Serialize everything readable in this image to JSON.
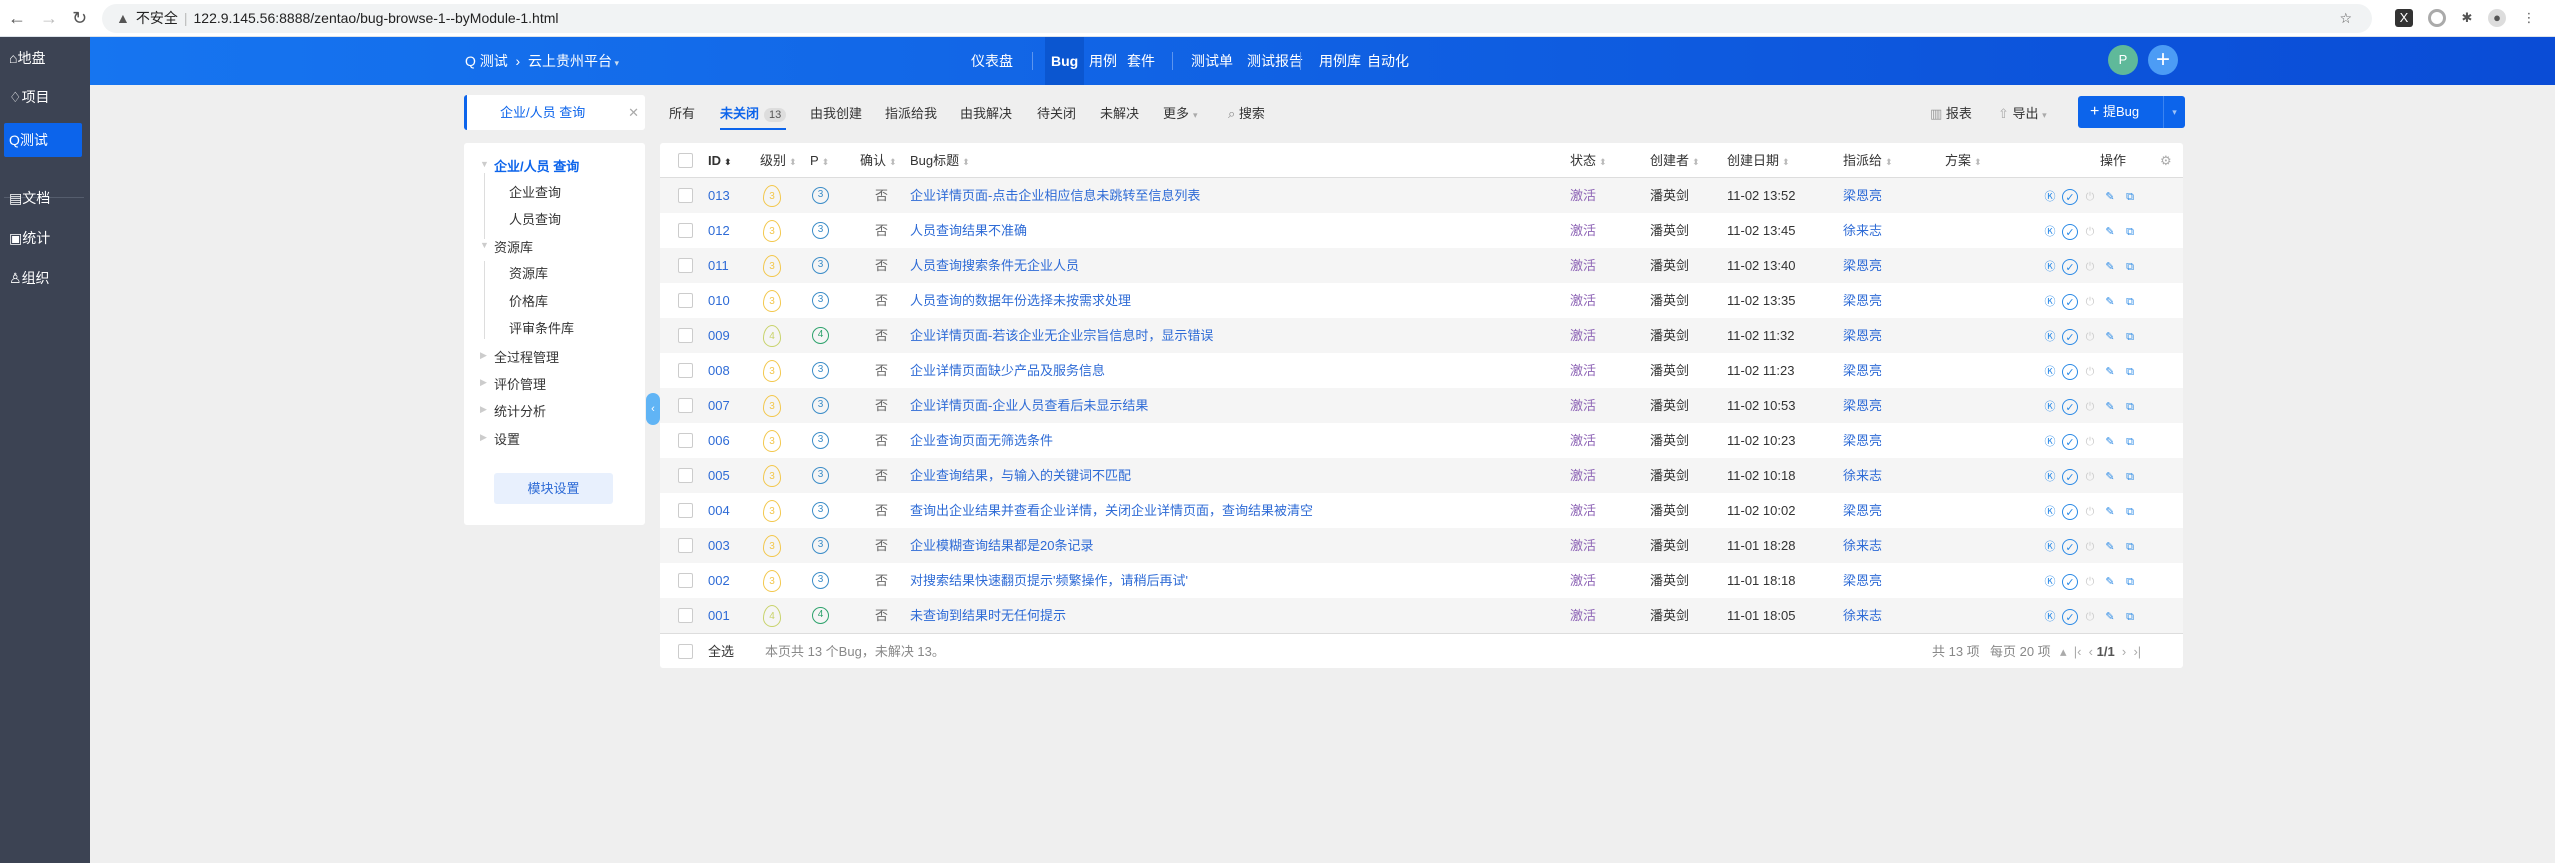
{
  "browser": {
    "security": "不安全",
    "url": "122.9.145.56:8888/zentao/bug-browse-1--byModule-1.html"
  },
  "sidebar": {
    "items": [
      {
        "label": "地盘",
        "icon": "home-icon"
      },
      {
        "label": "项目",
        "icon": "rocket-icon"
      },
      {
        "label": "测试",
        "icon": "test-icon"
      },
      {
        "label": "文档",
        "icon": "doc-icon"
      },
      {
        "label": "统计",
        "icon": "chart-icon"
      },
      {
        "label": "组织",
        "icon": "users-icon"
      }
    ]
  },
  "header": {
    "app": "测试",
    "product": "云上贵州平台",
    "nav": [
      "仪表盘",
      "Bug",
      "用例",
      "套件",
      "测试单",
      "测试报告",
      "用例库",
      "自动化"
    ],
    "avatar": "P"
  },
  "colors": {
    "accent": "#0c64eb",
    "sidebar": "#3c4353",
    "status": "#8d63b5"
  },
  "toolbar": {
    "module_tab": "企业/人员 查询",
    "tabs": [
      "所有",
      "未关闭",
      "由我创建",
      "指派给我",
      "由我解决",
      "待关闭",
      "未解决",
      "更多"
    ],
    "unclosed_count": "13",
    "search": "搜索",
    "report": "报表",
    "export": "导出",
    "create": "提Bug"
  },
  "tree": {
    "nodes": [
      "企业/人员 查询",
      "企业查询",
      "人员查询",
      "资源库",
      "资源库",
      "价格库",
      "评审条件库",
      "全过程管理",
      "评价管理",
      "统计分析",
      "设置"
    ],
    "module_settings": "模块设置"
  },
  "table": {
    "headers": [
      "ID",
      "级别",
      "P",
      "确认",
      "Bug标题",
      "状态",
      "创建者",
      "创建日期",
      "指派给",
      "方案",
      "操作"
    ],
    "rows": [
      {
        "id": "013",
        "sev": "3",
        "pri": "3",
        "confirmed": "否",
        "title": "企业详情页面-点击企业相应信息未跳转至信息列表",
        "status": "激活",
        "creator": "潘英剑",
        "date": "11-02 13:52",
        "assignee": "梁恩亮"
      },
      {
        "id": "012",
        "sev": "3",
        "pri": "3",
        "confirmed": "否",
        "title": "人员查询结果不准确",
        "status": "激活",
        "creator": "潘英剑",
        "date": "11-02 13:45",
        "assignee": "徐来志"
      },
      {
        "id": "011",
        "sev": "3",
        "pri": "3",
        "confirmed": "否",
        "title": "人员查询搜索条件无企业人员",
        "status": "激活",
        "creator": "潘英剑",
        "date": "11-02 13:40",
        "assignee": "梁恩亮"
      },
      {
        "id": "010",
        "sev": "3",
        "pri": "3",
        "confirmed": "否",
        "title": "人员查询的数据年份选择未按需求处理",
        "status": "激活",
        "creator": "潘英剑",
        "date": "11-02 13:35",
        "assignee": "梁恩亮"
      },
      {
        "id": "009",
        "sev": "4",
        "pri": "4",
        "confirmed": "否",
        "title": "企业详情页面-若该企业无企业宗旨信息时，显示错误",
        "status": "激活",
        "creator": "潘英剑",
        "date": "11-02 11:32",
        "assignee": "梁恩亮"
      },
      {
        "id": "008",
        "sev": "3",
        "pri": "3",
        "confirmed": "否",
        "title": "企业详情页面缺少产品及服务信息",
        "status": "激活",
        "creator": "潘英剑",
        "date": "11-02 11:23",
        "assignee": "梁恩亮"
      },
      {
        "id": "007",
        "sev": "3",
        "pri": "3",
        "confirmed": "否",
        "title": "企业详情页面-企业人员查看后未显示结果",
        "status": "激活",
        "creator": "潘英剑",
        "date": "11-02 10:53",
        "assignee": "梁恩亮"
      },
      {
        "id": "006",
        "sev": "3",
        "pri": "3",
        "confirmed": "否",
        "title": "企业查询页面无筛选条件",
        "status": "激活",
        "creator": "潘英剑",
        "date": "11-02 10:23",
        "assignee": "梁恩亮"
      },
      {
        "id": "005",
        "sev": "3",
        "pri": "3",
        "confirmed": "否",
        "title": "企业查询结果，与输入的关键词不匹配",
        "status": "激活",
        "creator": "潘英剑",
        "date": "11-02 10:18",
        "assignee": "徐来志"
      },
      {
        "id": "004",
        "sev": "3",
        "pri": "3",
        "confirmed": "否",
        "title": "查询出企业结果并查看企业详情，关闭企业详情页面，查询结果被清空",
        "status": "激活",
        "creator": "潘英剑",
        "date": "11-02 10:02",
        "assignee": "梁恩亮"
      },
      {
        "id": "003",
        "sev": "3",
        "pri": "3",
        "confirmed": "否",
        "title": "企业模糊查询结果都是20条记录",
        "status": "激活",
        "creator": "潘英剑",
        "date": "11-01 18:28",
        "assignee": "徐来志"
      },
      {
        "id": "002",
        "sev": "3",
        "pri": "3",
        "confirmed": "否",
        "title": "对搜索结果快速翻页提示'频繁操作，请稍后再试'",
        "status": "激活",
        "creator": "潘英剑",
        "date": "11-01 18:18",
        "assignee": "梁恩亮"
      },
      {
        "id": "001",
        "sev": "4",
        "pri": "4",
        "confirmed": "否",
        "title": "未查询到结果时无任何提示",
        "status": "激活",
        "creator": "潘英剑",
        "date": "11-01 18:05",
        "assignee": "徐来志"
      }
    ],
    "footer": {
      "select_all": "全选",
      "summary": "本页共 13 个Bug，未解决 13。",
      "total": "共 13 项",
      "per_page": "每页 20 项",
      "page": "1/1"
    }
  }
}
